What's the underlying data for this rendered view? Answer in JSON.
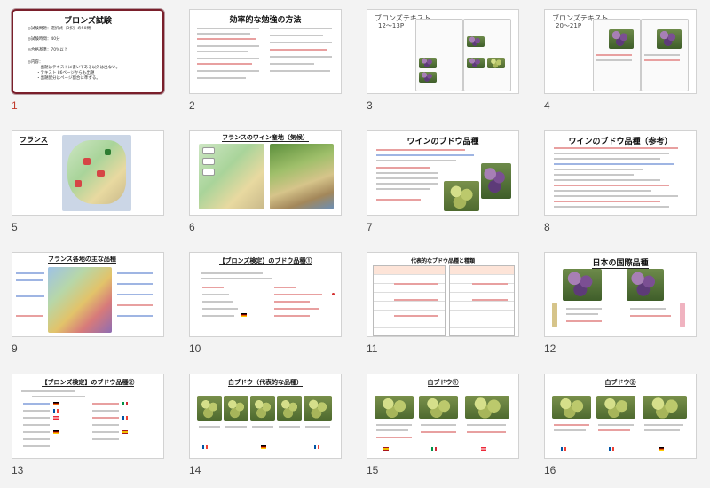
{
  "slides": [
    {
      "num": "1",
      "title": "ブロンズ試験",
      "lines": [
        "◎試験問題：選択式（3択）の50問",
        "◎試験時間：40分",
        "◎合格基準：70%以上",
        "◎内容：",
        "・出題はテキストに書いてある以外は出ない。",
        "・テキスト 86ページからも出題",
        "・出題配分はページ割合に準ずる。"
      ]
    },
    {
      "num": "2",
      "title": "効率的な勉強の方法"
    },
    {
      "num": "3",
      "title": "ブロンズテキスト",
      "subtitle": "12〜13P"
    },
    {
      "num": "4",
      "title": "ブロンズテキスト",
      "subtitle": "20〜21P"
    },
    {
      "num": "5",
      "title": "フランス"
    },
    {
      "num": "6",
      "title": "フランスのワイン産地（気候）"
    },
    {
      "num": "7",
      "title": "ワインのブドウ品種"
    },
    {
      "num": "8",
      "title": "ワインのブドウ品種（参考）"
    },
    {
      "num": "9",
      "title": "フランス各地の主な品種"
    },
    {
      "num": "10",
      "title": "【ブロンズ検定】のブドウ品種①"
    },
    {
      "num": "11",
      "title": "代表的なブドウ品種と種類"
    },
    {
      "num": "12",
      "title": "日本の国際品種"
    },
    {
      "num": "13",
      "title": "【ブロンズ検定】のブドウ品種②"
    },
    {
      "num": "14",
      "title": "白ブドウ（代表的な品種）"
    },
    {
      "num": "15",
      "title": "白ブドウ①"
    },
    {
      "num": "16",
      "title": "白ブドウ②"
    }
  ],
  "colors": {
    "selected_border": "#7a1f2b",
    "selected_number": "#c0392b",
    "accent_red": "#d32f2f"
  }
}
